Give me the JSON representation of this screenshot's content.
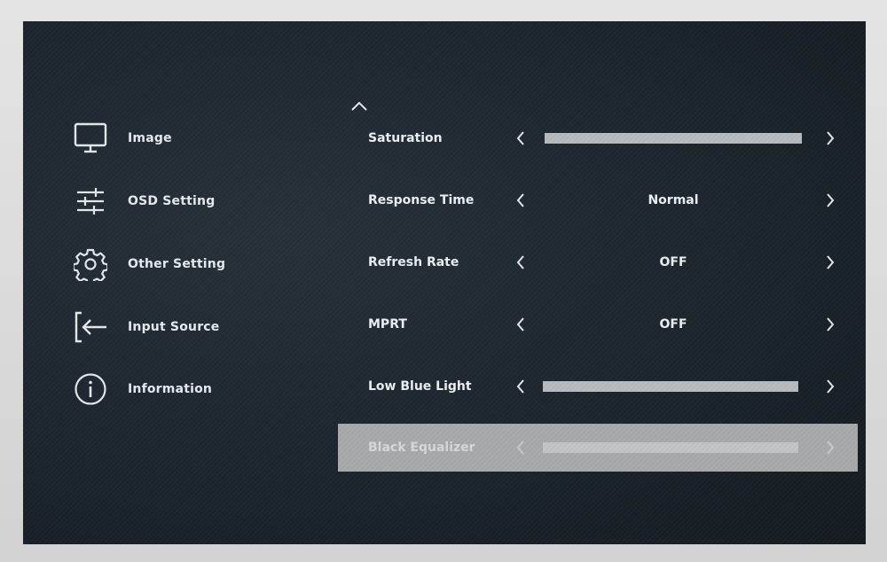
{
  "sidebar": {
    "items": [
      {
        "label": "Image",
        "icon": "monitor-icon"
      },
      {
        "label": "OSD Setting",
        "icon": "sliders-icon"
      },
      {
        "label": "Other Setting",
        "icon": "gear-icon"
      },
      {
        "label": "Input Source",
        "icon": "input-arrow-icon"
      },
      {
        "label": "Information",
        "icon": "info-icon"
      }
    ]
  },
  "settings": {
    "rows": [
      {
        "label": "Saturation",
        "type": "slider",
        "level": 1.0
      },
      {
        "label": "Response Time",
        "type": "value",
        "value": "Normal"
      },
      {
        "label": "Refresh Rate",
        "type": "value",
        "value": "OFF"
      },
      {
        "label": "MPRT",
        "type": "value",
        "value": "OFF"
      },
      {
        "label": "Low Blue Light",
        "type": "slider",
        "level": 1.0
      },
      {
        "label": "Black Equalizer",
        "type": "slider",
        "level": 1.0,
        "highlighted": true
      }
    ]
  },
  "colors": {
    "screen_bg": "#1c252d",
    "text": "#eef1f3",
    "highlight": "#a8aaab",
    "slider_fill": "#b9bcbf"
  }
}
